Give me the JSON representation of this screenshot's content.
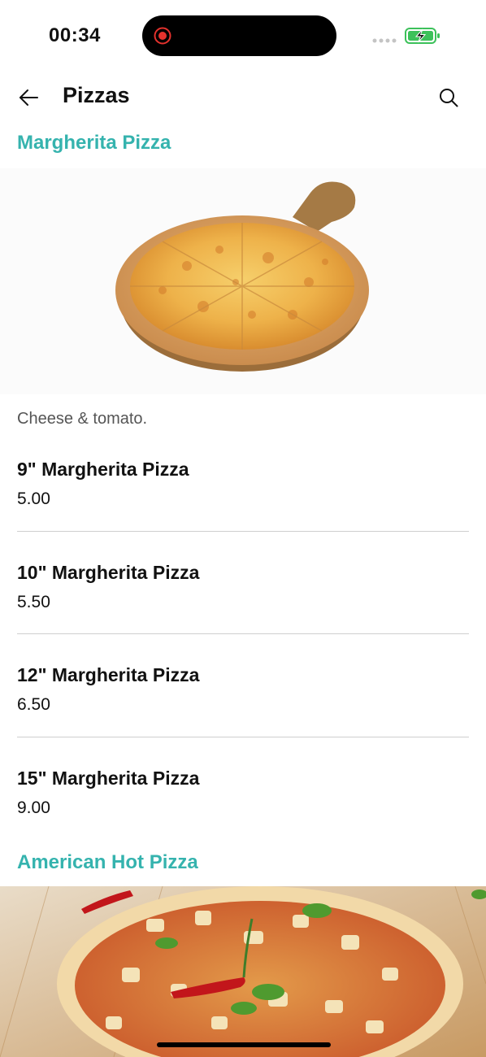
{
  "status_bar": {
    "time": "00:34",
    "icons": [
      "screen-record-icon",
      "cellular-signal-icon",
      "battery-charging-icon"
    ]
  },
  "app_bar": {
    "title": "Pizzas",
    "back_icon": "arrow-left-icon",
    "search_icon": "search-icon"
  },
  "sections": [
    {
      "title": "Margherita Pizza",
      "image": "margherita-pizza-photo",
      "description": "Cheese & tomato.",
      "items": [
        {
          "name": "9\" Margherita Pizza",
          "price": "5.00"
        },
        {
          "name": "10\" Margherita Pizza",
          "price": "5.50"
        },
        {
          "name": "12\" Margherita Pizza",
          "price": "6.50"
        },
        {
          "name": "15\" Margherita Pizza",
          "price": "9.00"
        }
      ]
    },
    {
      "title": "American Hot Pizza",
      "image": "american-hot-pizza-photo"
    }
  ],
  "colors": {
    "accent": "#35b3ae",
    "text": "#111111",
    "muted_text": "#555555",
    "divider": "#cfcfcf",
    "battery": "#3cc15a"
  }
}
